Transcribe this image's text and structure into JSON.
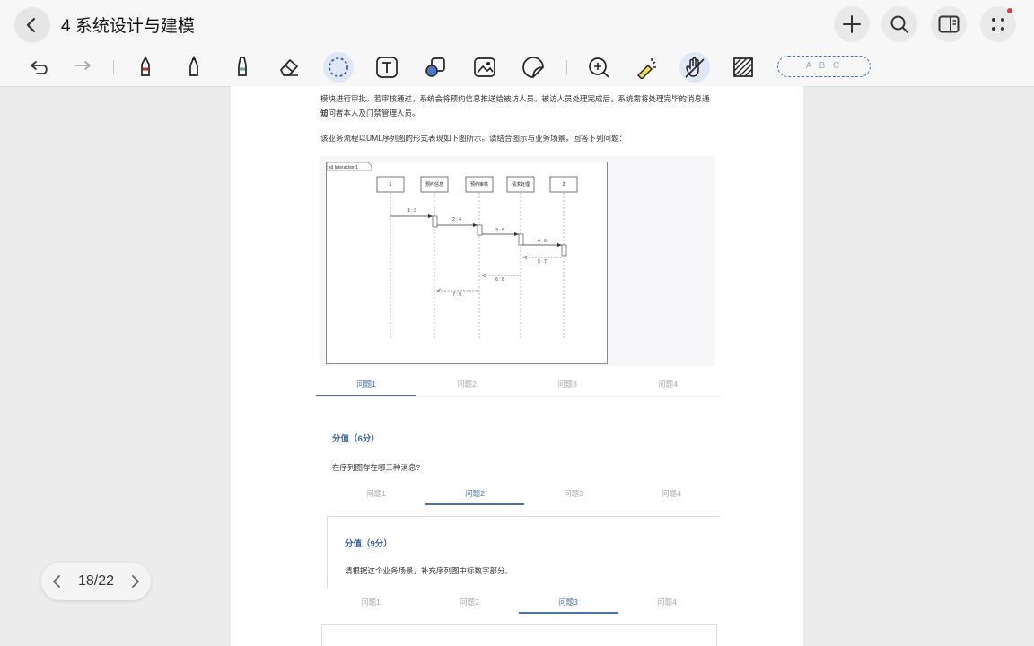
{
  "header": {
    "title": "4 系统设计与建模",
    "icons": [
      "back-icon",
      "plus-icon",
      "search-icon",
      "sidebar-icon",
      "more-icon"
    ]
  },
  "toolbar": {
    "tools": [
      "undo-icon",
      "redo-icon",
      "pen-icon",
      "marker-icon",
      "highlighter-icon",
      "eraser-icon",
      "lasso-icon",
      "text-box-icon",
      "shape-icon",
      "image-icon",
      "sticker-icon",
      "zoom-icon",
      "laser-pointer-icon",
      "hand-tool-icon",
      "pattern-icon"
    ],
    "abc_label": "A B C"
  },
  "document": {
    "paragraph1_line1": "模块进行审批。若审核通过，系统会将预约信息推送给被访人员。被访人员处理完成后，系统需将处理完毕的消息通知",
    "paragraph1_line2": "访问者本人及门禁管理人员。",
    "paragraph2": "该业务流程以UML序列图的形式表现如下图所示。请结合图示与业务场景，回答下列问题：",
    "diagram": {
      "frame_label": "sd Interaction1",
      "lifelines": [
        "1",
        "预约信息",
        "预约审核",
        "请求处理",
        "2"
      ],
      "messages": [
        "1 : 3",
        "2 : 4",
        "3 : 5",
        "4 : 6",
        "5 : 7",
        "6 : 8",
        "7 : 9"
      ]
    },
    "tabs_group1": [
      "问题1",
      "问题2",
      "问题3",
      "问题4"
    ],
    "section1": {
      "score": "分值（6分）",
      "question": "在序列图存在哪三种消息?"
    },
    "tabs_group2": [
      "问题1",
      "问题2",
      "问题3",
      "问题4"
    ],
    "section2": {
      "score": "分值（9分）",
      "question": "请根据这个业务场景，补充序列图中标数字部分。"
    },
    "tabs_group3": [
      "问题1",
      "问题2",
      "问题3",
      "问题4"
    ]
  },
  "pager": {
    "label": "18/22"
  }
}
